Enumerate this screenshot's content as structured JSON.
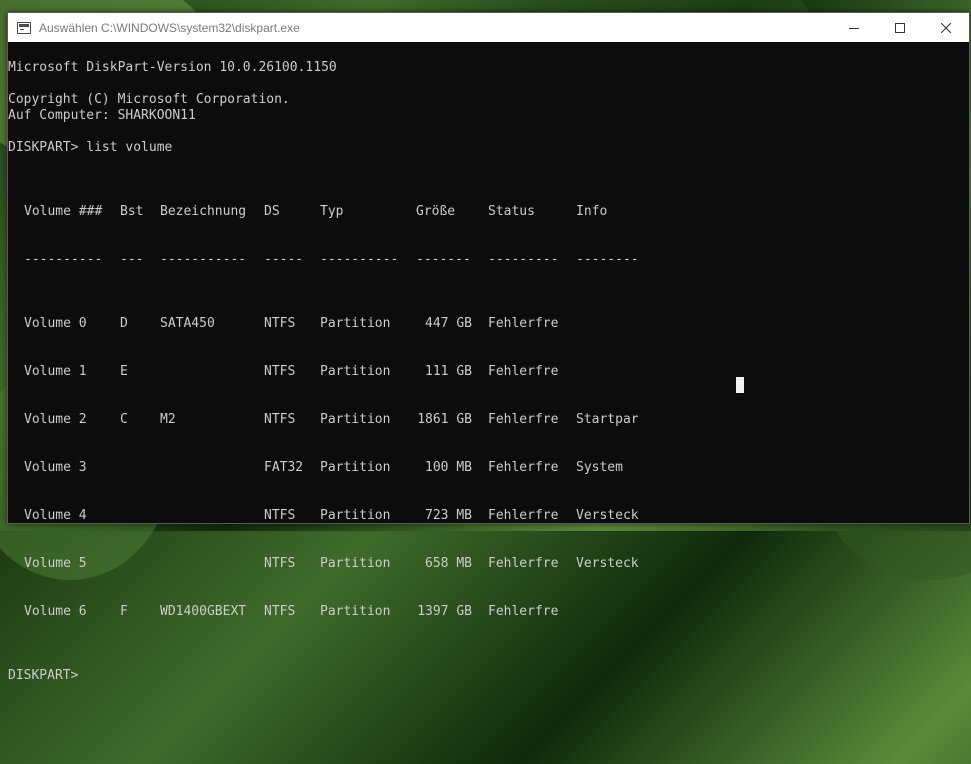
{
  "window": {
    "title": "Auswählen C:\\WINDOWS\\system32\\diskpart.exe"
  },
  "console": {
    "version_line": "Microsoft DiskPart-Version 10.0.26100.1150",
    "copyright_line": "Copyright (C) Microsoft Corporation.",
    "computer_line": "Auf Computer: SHARKOON11",
    "command_line": "DISKPART> list volume",
    "prompt_line": "DISKPART>",
    "table": {
      "headers": {
        "volume": "Volume ###",
        "bst": "Bst",
        "bezeichnung": "Bezeichnung",
        "ds": "DS",
        "typ": "Typ",
        "groesse": "Größe",
        "status": "Status",
        "info": "Info"
      },
      "separators": {
        "volume": "----------",
        "bst": "---",
        "bezeichnung": "-----------",
        "ds": "-----",
        "typ": "----------",
        "groesse": "-------",
        "status": "---------",
        "info": "--------"
      },
      "rows": [
        {
          "volume": "Volume 0",
          "bst": "D",
          "bezeichnung": "SATA450",
          "ds": "NTFS",
          "typ": "Partition",
          "groesse": "447 GB",
          "status": "Fehlerfre",
          "info": ""
        },
        {
          "volume": "Volume 1",
          "bst": "E",
          "bezeichnung": "",
          "ds": "NTFS",
          "typ": "Partition",
          "groesse": "111 GB",
          "status": "Fehlerfre",
          "info": ""
        },
        {
          "volume": "Volume 2",
          "bst": "C",
          "bezeichnung": "M2",
          "ds": "NTFS",
          "typ": "Partition",
          "groesse": "1861 GB",
          "status": "Fehlerfre",
          "info": "Startpar"
        },
        {
          "volume": "Volume 3",
          "bst": "",
          "bezeichnung": "",
          "ds": "FAT32",
          "typ": "Partition",
          "groesse": "100 MB",
          "status": "Fehlerfre",
          "info": "System"
        },
        {
          "volume": "Volume 4",
          "bst": "",
          "bezeichnung": "",
          "ds": "NTFS",
          "typ": "Partition",
          "groesse": "723 MB",
          "status": "Fehlerfre",
          "info": "Versteck"
        },
        {
          "volume": "Volume 5",
          "bst": "",
          "bezeichnung": "",
          "ds": "NTFS",
          "typ": "Partition",
          "groesse": "658 MB",
          "status": "Fehlerfre",
          "info": "Versteck"
        },
        {
          "volume": "Volume 6",
          "bst": "F",
          "bezeichnung": "WD1400GBEXT",
          "ds": "NTFS",
          "typ": "Partition",
          "groesse": "1397 GB",
          "status": "Fehlerfre",
          "info": ""
        }
      ]
    }
  },
  "colors": {
    "console_bg": "#0c0c0c",
    "console_text": "#cccccc",
    "titlebar_bg": "#ffffff",
    "title_text": "#7a7a7a"
  },
  "icons": {
    "app": "console-app-icon",
    "minimize": "minimize-icon",
    "maximize": "maximize-icon",
    "close": "close-icon"
  }
}
